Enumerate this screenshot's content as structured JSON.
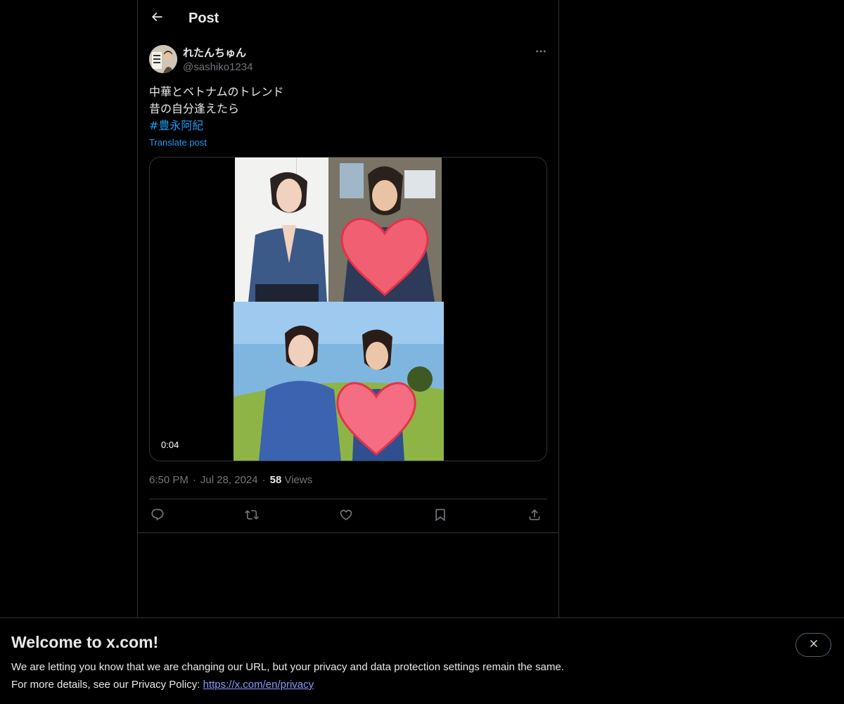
{
  "header": {
    "title": "Post",
    "back_icon": "arrow-left-icon"
  },
  "post": {
    "author": {
      "display_name": "れたんちゅん",
      "handle": "@sashiko1234",
      "avatar_icon": "avatar-image"
    },
    "more_icon": "more-horizontal-icon",
    "text_lines": [
      "中華とベトナムのトレンド",
      "昔の自分逢えたら"
    ],
    "hashtag": "#豊永阿紀",
    "translate_label": "Translate post",
    "media": {
      "duration": "0:04",
      "type": "video"
    },
    "time": "6:50 PM",
    "separator": "·",
    "date": "Jul 28, 2024",
    "views_count": "58",
    "views_label": "Views"
  },
  "actions": {
    "reply_icon": "reply-icon",
    "repost_icon": "repost-icon",
    "like_icon": "heart-icon",
    "bookmark_icon": "bookmark-icon",
    "share_icon": "share-icon"
  },
  "banner": {
    "title": "Welcome to x.com!",
    "line1": "We are letting you know that we are changing our URL, but your privacy and data protection settings remain the same.",
    "line2_prefix": "For more details, see our Privacy Policy: ",
    "link": "https://x.com/en/privacy",
    "close_icon": "close-icon"
  },
  "colors": {
    "background": "#000000",
    "text": "#e7e9ea",
    "muted": "#71767b",
    "accent": "#1d9bf0",
    "border": "#2f3336",
    "link": "#8b98ff"
  }
}
